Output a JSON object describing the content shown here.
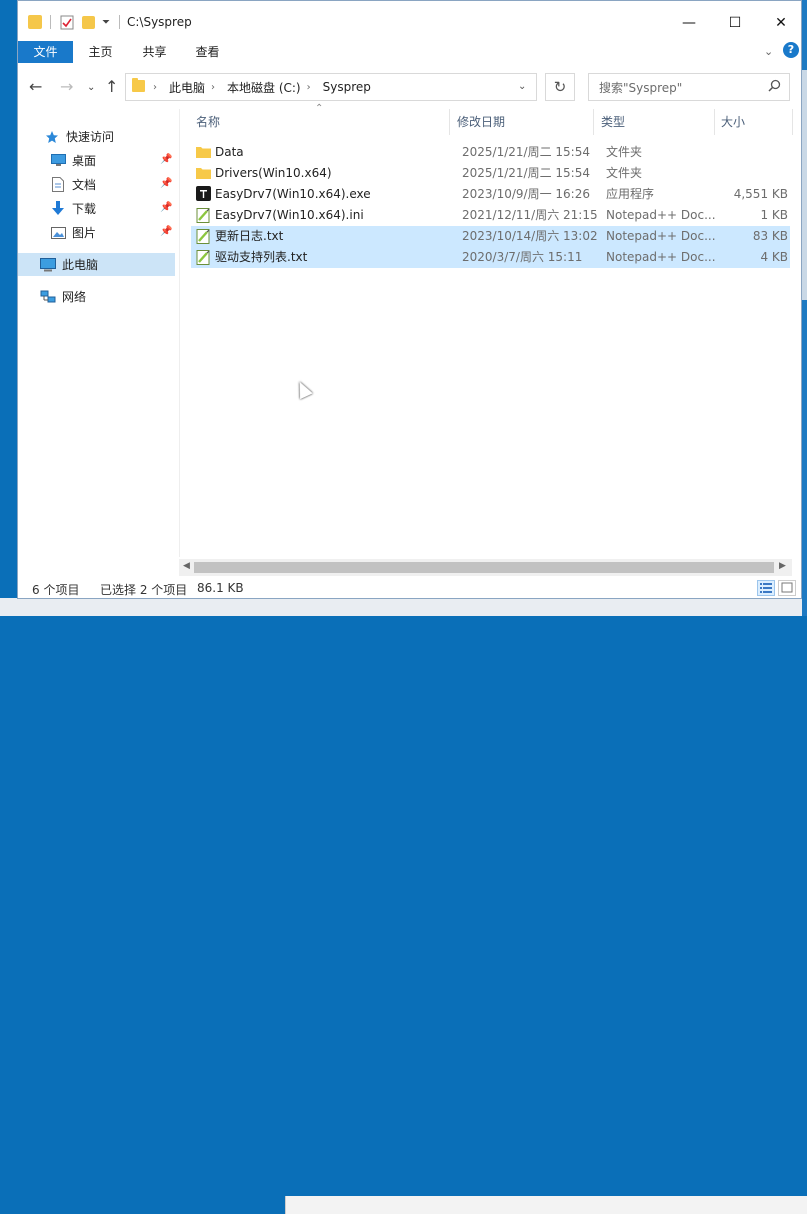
{
  "window": {
    "title": "C:\\Sysprep",
    "controls": {
      "minimize": "—",
      "maximize": "☐",
      "close": "✕"
    }
  },
  "ribbon": {
    "tabs": [
      {
        "label": "文件",
        "active": true
      },
      {
        "label": "主页",
        "active": false
      },
      {
        "label": "共享",
        "active": false
      },
      {
        "label": "查看",
        "active": false
      }
    ],
    "collapse": "⌄",
    "help": "?"
  },
  "navigation": {
    "back": "←",
    "forward": "→",
    "recent": "⌄",
    "up": "↑",
    "breadcrumbs": [
      "此电脑",
      "本地磁盘 (C:)",
      "Sysprep"
    ],
    "refresh": "↻",
    "search_placeholder": "搜索\"Sysprep\"",
    "search_icon": "⚲"
  },
  "sidebar": {
    "quick_access": "快速访问",
    "items": [
      {
        "label": "桌面",
        "icon": "desktop-icon",
        "pinned": true
      },
      {
        "label": "文档",
        "icon": "document-icon",
        "pinned": true
      },
      {
        "label": "下载",
        "icon": "download-icon",
        "pinned": true
      },
      {
        "label": "图片",
        "icon": "picture-icon",
        "pinned": true
      }
    ],
    "this_pc": "此电脑",
    "network": "网络"
  },
  "columns": {
    "name": "名称",
    "modified": "修改日期",
    "type": "类型",
    "size": "大小"
  },
  "files": [
    {
      "name": "Data",
      "modified": "2025/1/21/周二 15:54",
      "type": "文件夹",
      "size": "",
      "icon": "folder",
      "selected": false
    },
    {
      "name": "Drivers(Win10.x64)",
      "modified": "2025/1/21/周二 15:54",
      "type": "文件夹",
      "size": "",
      "icon": "folder",
      "selected": false
    },
    {
      "name": "EasyDrv7(Win10.x64).exe",
      "modified": "2023/10/9/周一 16:26",
      "type": "应用程序",
      "size": "4,551 KB",
      "icon": "exe",
      "selected": false
    },
    {
      "name": "EasyDrv7(Win10.x64).ini",
      "modified": "2021/12/11/周六 21:15",
      "type": "Notepad++ Doc...",
      "size": "1 KB",
      "icon": "notepad",
      "selected": false
    },
    {
      "name": "更新日志.txt",
      "modified": "2023/10/14/周六 13:02",
      "type": "Notepad++ Doc...",
      "size": "83 KB",
      "icon": "notepad",
      "selected": true
    },
    {
      "name": "驱动支持列表.txt",
      "modified": "2020/3/7/周六 15:11",
      "type": "Notepad++ Doc...",
      "size": "4 KB",
      "icon": "notepad",
      "selected": true
    }
  ],
  "status": {
    "count": "6 个项目",
    "selected": "已选择 2 个项目",
    "size": "86.1 KB"
  },
  "colors": {
    "accent": "#1979ca",
    "selection": "#cce8ff",
    "folder": "#f7c948"
  }
}
